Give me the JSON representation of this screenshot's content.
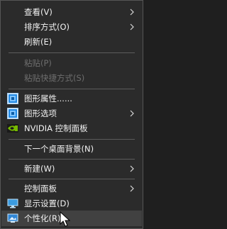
{
  "context_menu": {
    "items": [
      {
        "label": "查看(V)",
        "icon": "",
        "submenu": true,
        "disabled": false
      },
      {
        "label": "排序方式(O)",
        "icon": "",
        "submenu": true,
        "disabled": false
      },
      {
        "label": "刷新(E)",
        "icon": "",
        "submenu": false,
        "disabled": false
      },
      {
        "label": "粘贴(P)",
        "icon": "",
        "submenu": false,
        "disabled": true
      },
      {
        "label": "粘贴快捷方式(S)",
        "icon": "",
        "submenu": false,
        "disabled": true
      },
      {
        "label": "图形属性......",
        "icon": "intel-graphics-icon",
        "submenu": false,
        "disabled": false
      },
      {
        "label": "图形选项",
        "icon": "intel-graphics-icon",
        "submenu": true,
        "disabled": false
      },
      {
        "label": "NVIDIA 控制面板",
        "icon": "nvidia-icon",
        "submenu": false,
        "disabled": false
      },
      {
        "label": "下一个桌面背景(N)",
        "icon": "",
        "submenu": false,
        "disabled": false
      },
      {
        "label": "新建(W)",
        "icon": "",
        "submenu": true,
        "disabled": false
      },
      {
        "label": "控制面板",
        "icon": "",
        "submenu": true,
        "disabled": false
      },
      {
        "label": "显示设置(D)",
        "icon": "display-settings-icon",
        "submenu": false,
        "disabled": false
      },
      {
        "label": "个性化(R)",
        "icon": "personalize-icon",
        "submenu": false,
        "disabled": false,
        "highlighted": true
      }
    ]
  },
  "colors": {
    "menu_background": "#2b2b2b",
    "text": "#f2f2f2",
    "disabled_text": "#6d6d6d",
    "separator": "#5c5c5c",
    "hover_background": "#414141",
    "nvidia_green": "#76b900",
    "intel_blue": "#1e88e5"
  }
}
